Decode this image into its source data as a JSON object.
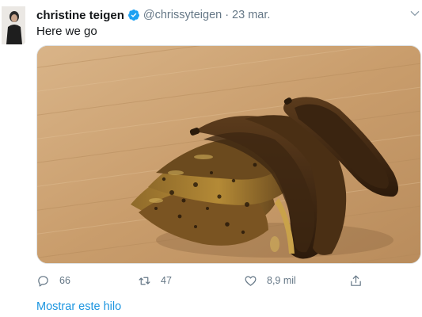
{
  "tweet": {
    "display_name": "christine teigen",
    "handle": "@chrissyteigen",
    "separator": "·",
    "timestamp": "23 mar.",
    "text": "Here we go",
    "verified_icon": "verified-badge-icon",
    "menu_icon": "chevron-down-icon",
    "media_description_icon": "photo",
    "actions": {
      "reply": {
        "icon": "reply-icon",
        "count": "66"
      },
      "retweet": {
        "icon": "retweet-icon",
        "count": "47"
      },
      "like": {
        "icon": "heart-icon",
        "count": "8,9 mil"
      },
      "share": {
        "icon": "share-icon",
        "count": ""
      }
    },
    "show_thread_label": "Mostrar este hilo"
  },
  "colors": {
    "name": "#14171a",
    "secondary": "#657786",
    "link": "#1b95e0",
    "verified": "#1da1f2"
  }
}
